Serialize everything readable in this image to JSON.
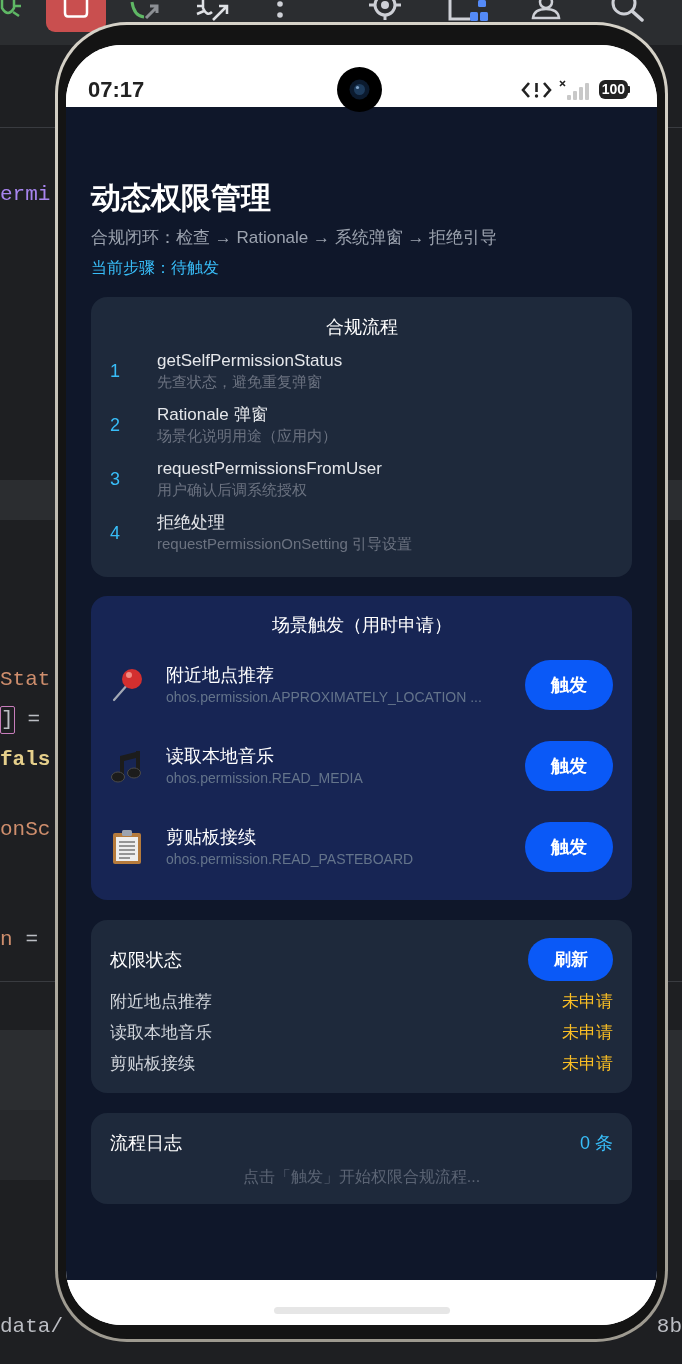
{
  "ide": {
    "code_lines": [
      {
        "tokens": [
          {
            "text": "ermi",
            "kind": "field"
          }
        ]
      },
      {
        "tokens": [
          {
            "text": "Stat",
            "kind": "property"
          }
        ]
      },
      {
        "tokens": [
          {
            "text": "]",
            "kind": "bracket"
          },
          {
            "text": "=",
            "kind": "operator"
          }
        ]
      },
      {
        "tokens": [
          {
            "text": "fals",
            "kind": "keyword"
          }
        ]
      },
      {
        "tokens": [
          {
            "text": "onSc",
            "kind": "property"
          }
        ]
      },
      {
        "tokens": [
          {
            "text": "n",
            "kind": "property"
          },
          {
            "text": "=",
            "kind": "operator"
          }
        ]
      }
    ],
    "path_fragments": [
      {
        "text": "data/"
      },
      {
        "text": "8b"
      }
    ]
  },
  "phone": {
    "status_bar": {
      "time": "07:17",
      "battery": "100"
    },
    "app": {
      "title": "动态权限管理",
      "subtitle": "合规闭环：检查 → Rationale → 系统弹窗 → 拒绝引导",
      "current_step": "当前步骤：待触发",
      "flow_card": {
        "title": "合规流程",
        "steps": [
          {
            "number": "1",
            "title": "getSelfPermissionStatus",
            "description": "先查状态，避免重复弹窗"
          },
          {
            "number": "2",
            "title": "Rationale 弹窗",
            "description": "场景化说明用途（应用内）"
          },
          {
            "number": "3",
            "title": "requestPermissionsFromUser",
            "description": "用户确认后调系统授权"
          },
          {
            "number": "4",
            "title": "拒绝处理",
            "description": "requestPermissionOnSetting 引导设置"
          }
        ]
      },
      "scene_card": {
        "title": "场景触发（用时申请）",
        "scenes": [
          {
            "kind": "location",
            "name": "附近地点推荐",
            "permission": "ohos.permission.APPROXIMATELY_LOCATION ...",
            "button": "触发"
          },
          {
            "kind": "media",
            "name": "读取本地音乐",
            "permission": "ohos.permission.READ_MEDIA",
            "button": "触发"
          },
          {
            "kind": "clipboard",
            "name": "剪贴板接续",
            "permission": "ohos.permission.READ_PASTEBOARD",
            "button": "触发"
          }
        ]
      },
      "status_card": {
        "title": "权限状态",
        "button": "刷新",
        "rows": [
          {
            "name": "附近地点推荐",
            "status": "未申请"
          },
          {
            "name": "读取本地音乐",
            "status": "未申请"
          },
          {
            "name": "剪贴板接续",
            "status": "未申请"
          }
        ]
      },
      "log_card": {
        "title": "流程日志",
        "count": "0 条",
        "empty_message": "点击「触发」开始权限合规流程..."
      }
    }
  }
}
